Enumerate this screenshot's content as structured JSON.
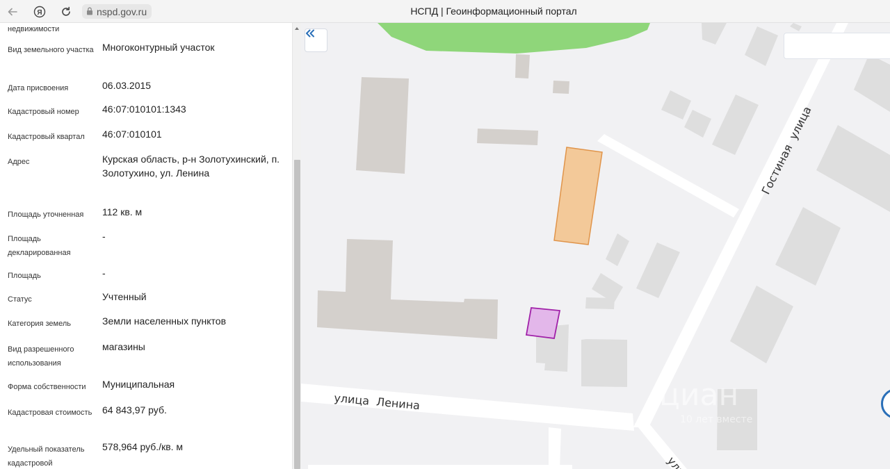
{
  "browser": {
    "url": "nspd.gov.ru",
    "title": "НСПД | Геоинформационный портал",
    "icons": [
      "back-arrow-icon",
      "yandex-logo-icon",
      "reload-icon",
      "lock-icon"
    ]
  },
  "info": {
    "top_cut_label": "недвижимости",
    "fields": [
      {
        "label": "Вид земельного участка",
        "value": "Многоконтурный участок"
      },
      {
        "label": "Дата присвоения",
        "value": "06.03.2015"
      },
      {
        "label": "Кадастровый номер",
        "value": "46:07:010101:1343"
      },
      {
        "label": "Кадастровый квартал",
        "value": "46:07:010101"
      },
      {
        "label": "Адрес",
        "value": "Курская область, р-н Золотухинский, п. Золотухино, ул. Ленина"
      },
      {
        "label": "Площадь уточненная",
        "value": "112 кв. м"
      },
      {
        "label": "Площадь декларированная",
        "value": "-"
      },
      {
        "label": "Площадь",
        "value": "-"
      },
      {
        "label": "Статус",
        "value": "Учтенный"
      },
      {
        "label": "Категория земель",
        "value": "Земли населенных пунктов"
      },
      {
        "label": "Вид разрешенного использования",
        "value": "магазины"
      },
      {
        "label": "Форма собственности",
        "value": "Муниципальная"
      },
      {
        "label": "Кадастровая стоимость",
        "value": "64 843,97 руб."
      },
      {
        "label": "Удельный показатель кадастровой",
        "value": "578,964 руб./кв. м"
      }
    ]
  },
  "map": {
    "streets": {
      "lenina": "улица  Ленина",
      "gostinaya": "Гостиная  улица",
      "bottom_cut": "ули"
    },
    "watermark": "циан",
    "watermark_sub": "10 лет вместе",
    "colors": {
      "background": "#f1f1f3",
      "park": "#8fd67a",
      "building": "#d4d0cc",
      "building_light": "#dedede",
      "road": "#ffffff",
      "highlight_fill": "#f3c999",
      "highlight_stroke": "#e0944a",
      "selected_fill": "#e3b7ea",
      "selected_stroke": "#a020a8",
      "accent": "#2a6fb8"
    }
  }
}
